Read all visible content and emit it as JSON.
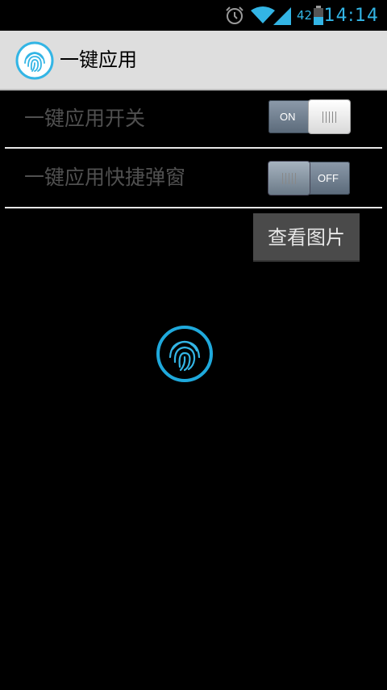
{
  "status_bar": {
    "icons": [
      "alarm-icon",
      "wifi-icon",
      "signal-icon",
      "battery-icon"
    ],
    "battery_percent": "42",
    "time": "14:14"
  },
  "action_bar": {
    "title": "一键应用",
    "icon": "fingerprint-icon"
  },
  "settings": [
    {
      "label": "一键应用开关",
      "toggle_text": "ON",
      "enabled": true
    },
    {
      "label": "一键应用快捷弹窗",
      "toggle_text": "OFF",
      "enabled": false
    }
  ],
  "view_button_label": "查看图片",
  "center_icon": "fingerprint-icon",
  "colors": {
    "accent": "#33b5e5",
    "background": "#000000",
    "action_bar": "#dedede",
    "label_text": "#505050",
    "button_bg": "#4a4a4a"
  }
}
